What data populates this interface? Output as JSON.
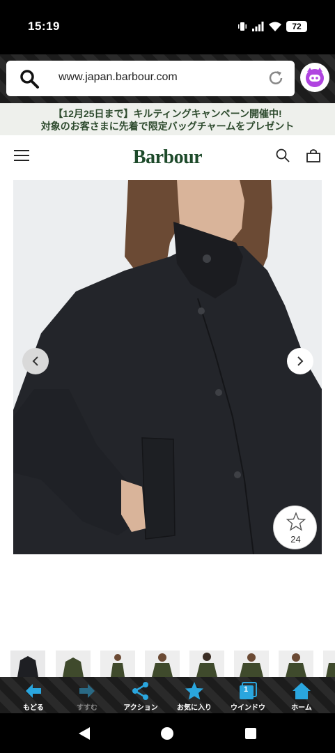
{
  "status_bar": {
    "time": "15:19",
    "battery": "72"
  },
  "browser": {
    "url": "www.japan.barbour.com"
  },
  "promo": {
    "line1": "【12月25日まで】キルティングキャンペーン開催中!",
    "line2": "対象のお客さまに先着で限定バッグチャームをプレゼント"
  },
  "site": {
    "logo": "Barbour"
  },
  "product": {
    "favorite_count": "24"
  },
  "bottom_nav": {
    "items": [
      {
        "label": "もどる",
        "icon": "back-arrow-icon",
        "enabled": true
      },
      {
        "label": "すすむ",
        "icon": "forward-arrow-icon",
        "enabled": false
      },
      {
        "label": "アクション",
        "icon": "share-icon",
        "enabled": true
      },
      {
        "label": "お気に入り",
        "icon": "star-icon",
        "enabled": true
      },
      {
        "label": "ウインドウ",
        "icon": "window-icon",
        "enabled": true,
        "badge": "1"
      },
      {
        "label": "ホーム",
        "icon": "home-icon",
        "enabled": true
      }
    ]
  },
  "colors": {
    "brand_green": "#1d4a2a",
    "nav_accent": "#2aa6de",
    "promo_text": "#2d4a2d"
  }
}
